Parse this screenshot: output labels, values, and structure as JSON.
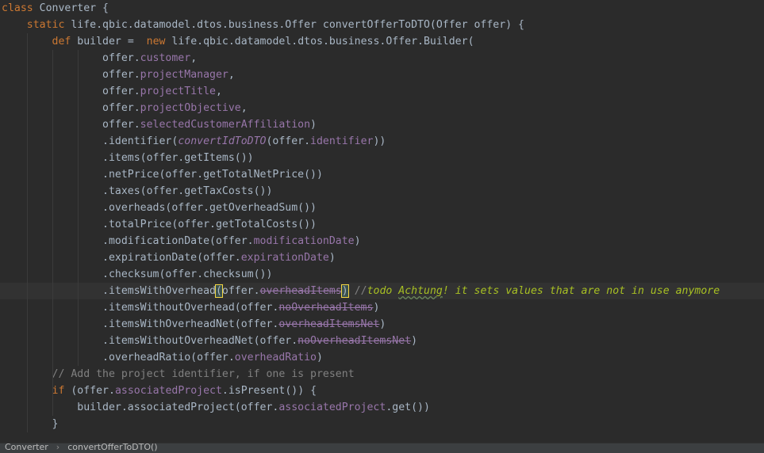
{
  "code": {
    "lines": [
      {
        "tokens": [
          {
            "t": "class ",
            "s": "keyword"
          },
          {
            "t": "Converter {",
            "s": "plain"
          }
        ]
      },
      {
        "tokens": [
          {
            "t": "    ",
            "s": "plain"
          },
          {
            "t": "static ",
            "s": "keyword"
          },
          {
            "t": "life.qbic.datamodel.dtos.business.Offer convertOfferToDTO(Offer offer) {",
            "s": "plain"
          }
        ]
      },
      {
        "tokens": [
          {
            "t": "        ",
            "s": "plain"
          },
          {
            "t": "def ",
            "s": "keyword"
          },
          {
            "t": "builder =  ",
            "s": "plain"
          },
          {
            "t": "new ",
            "s": "keyword"
          },
          {
            "t": "life.qbic.datamodel.dtos.business.Offer.Builder(",
            "s": "plain"
          }
        ]
      },
      {
        "tokens": [
          {
            "t": "                offer.",
            "s": "plain"
          },
          {
            "t": "customer",
            "s": "field"
          },
          {
            "t": ",",
            "s": "plain"
          }
        ]
      },
      {
        "tokens": [
          {
            "t": "                offer.",
            "s": "plain"
          },
          {
            "t": "projectManager",
            "s": "field"
          },
          {
            "t": ",",
            "s": "plain"
          }
        ]
      },
      {
        "tokens": [
          {
            "t": "                offer.",
            "s": "plain"
          },
          {
            "t": "projectTitle",
            "s": "field"
          },
          {
            "t": ",",
            "s": "plain"
          }
        ]
      },
      {
        "tokens": [
          {
            "t": "                offer.",
            "s": "plain"
          },
          {
            "t": "projectObjective",
            "s": "field"
          },
          {
            "t": ",",
            "s": "plain"
          }
        ]
      },
      {
        "tokens": [
          {
            "t": "                offer.",
            "s": "plain"
          },
          {
            "t": "selectedCustomerAffiliation",
            "s": "field"
          },
          {
            "t": ")",
            "s": "plain"
          }
        ]
      },
      {
        "tokens": [
          {
            "t": "                .identifier(",
            "s": "plain"
          },
          {
            "t": "convertIdToDTO",
            "s": "static-call"
          },
          {
            "t": "(offer.",
            "s": "plain"
          },
          {
            "t": "identifier",
            "s": "field"
          },
          {
            "t": "))",
            "s": "plain"
          }
        ]
      },
      {
        "tokens": [
          {
            "t": "                .items(offer.getItems())",
            "s": "plain"
          }
        ]
      },
      {
        "tokens": [
          {
            "t": "                .netPrice(offer.getTotalNetPrice())",
            "s": "plain"
          }
        ]
      },
      {
        "tokens": [
          {
            "t": "                .taxes(offer.getTaxCosts())",
            "s": "plain"
          }
        ]
      },
      {
        "tokens": [
          {
            "t": "                .overheads(offer.getOverheadSum())",
            "s": "plain"
          }
        ]
      },
      {
        "tokens": [
          {
            "t": "                .totalPrice(offer.getTotalCosts())",
            "s": "plain"
          }
        ]
      },
      {
        "tokens": [
          {
            "t": "                .modificationDate(offer.",
            "s": "plain"
          },
          {
            "t": "modificationDate",
            "s": "field"
          },
          {
            "t": ")",
            "s": "plain"
          }
        ]
      },
      {
        "tokens": [
          {
            "t": "                .expirationDate(offer.",
            "s": "plain"
          },
          {
            "t": "expirationDate",
            "s": "field"
          },
          {
            "t": ")",
            "s": "plain"
          }
        ]
      },
      {
        "tokens": [
          {
            "t": "                .checksum(offer.checksum())",
            "s": "plain"
          }
        ]
      },
      {
        "current": true,
        "tokens": [
          {
            "t": "                .itemsWithOverhead",
            "s": "plain"
          },
          {
            "t": "(",
            "s": "brace-match"
          },
          {
            "t": "offer.",
            "s": "plain"
          },
          {
            "t": "overheadItems",
            "s": "deprecated"
          },
          {
            "t": ")",
            "s": "brace-match"
          },
          {
            "t": " ",
            "s": "plain"
          },
          {
            "t": "//",
            "s": "comment"
          },
          {
            "t": "todo ",
            "s": "todo"
          },
          {
            "t": "Achtung",
            "s": "todo-squiggle"
          },
          {
            "t": "! it sets values that are not in use anymore",
            "s": "todo"
          }
        ]
      },
      {
        "tokens": [
          {
            "t": "                .itemsWithoutOverhead(offer.",
            "s": "plain"
          },
          {
            "t": "noOverheadItems",
            "s": "deprecated"
          },
          {
            "t": ")",
            "s": "plain"
          }
        ]
      },
      {
        "tokens": [
          {
            "t": "                .itemsWithOverheadNet(offer.",
            "s": "plain"
          },
          {
            "t": "overheadItemsNet",
            "s": "deprecated"
          },
          {
            "t": ")",
            "s": "plain"
          }
        ]
      },
      {
        "tokens": [
          {
            "t": "                .itemsWithoutOverheadNet(offer.",
            "s": "plain"
          },
          {
            "t": "noOverheadItemsNet",
            "s": "deprecated"
          },
          {
            "t": ")",
            "s": "plain"
          }
        ]
      },
      {
        "tokens": [
          {
            "t": "                .overheadRatio(offer.",
            "s": "plain"
          },
          {
            "t": "overheadRatio",
            "s": "field"
          },
          {
            "t": ")",
            "s": "plain"
          }
        ]
      },
      {
        "tokens": [
          {
            "t": "        ",
            "s": "plain"
          },
          {
            "t": "// Add the project identifier, if one is present",
            "s": "comment"
          }
        ]
      },
      {
        "tokens": [
          {
            "t": "        ",
            "s": "plain"
          },
          {
            "t": "if ",
            "s": "keyword"
          },
          {
            "t": "(offer.",
            "s": "plain"
          },
          {
            "t": "associatedProject",
            "s": "field"
          },
          {
            "t": ".isPresent()) {",
            "s": "plain"
          }
        ]
      },
      {
        "tokens": [
          {
            "t": "            builder.associatedProject(offer.",
            "s": "plain"
          },
          {
            "t": "associatedProject",
            "s": "field"
          },
          {
            "t": ".get())",
            "s": "plain"
          }
        ]
      },
      {
        "tokens": [
          {
            "t": "        }",
            "s": "plain"
          }
        ]
      },
      {
        "tokens": []
      }
    ]
  },
  "breadcrumb": {
    "items": [
      "Converter",
      "convertOfferToDTO()"
    ]
  },
  "colors": {
    "background": "#2b2b2b",
    "keyword": "#cc7832",
    "field": "#9876aa",
    "comment": "#808080",
    "todo": "#a8c023",
    "plain": "#a9b7c6"
  }
}
